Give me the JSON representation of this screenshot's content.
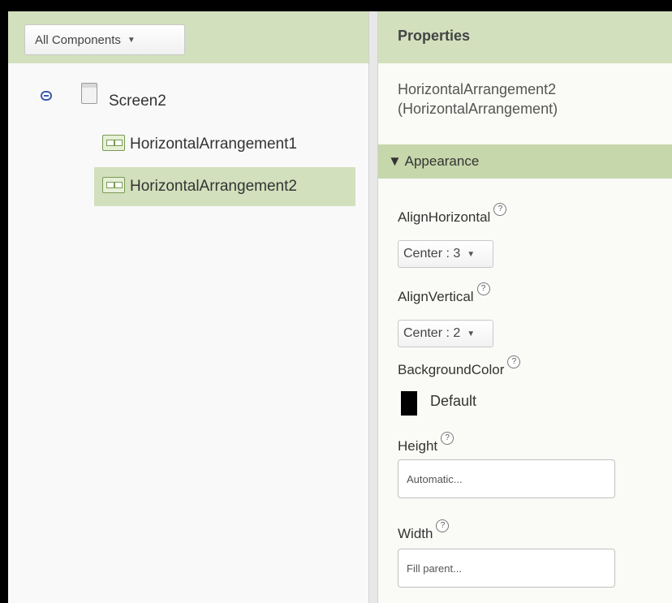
{
  "components": {
    "dropdown_label": "All Components",
    "tree": {
      "root": "Screen2",
      "children": [
        "HorizontalArrangement1",
        "HorizontalArrangement2"
      ],
      "selected": "HorizontalArrangement2"
    }
  },
  "properties": {
    "header": "Properties",
    "component_name_line1": "HorizontalArrangement2",
    "component_name_line2": "(HorizontalArrangement)",
    "section_label": "▼ Appearance",
    "help_glyph": "?",
    "align_horizontal": {
      "label": "AlignHorizontal",
      "value": "Center : 3"
    },
    "align_vertical": {
      "label": "AlignVertical",
      "value": "Center : 2"
    },
    "background_color": {
      "label": "BackgroundColor",
      "value": "Default",
      "swatch_color": "#000000"
    },
    "height": {
      "label": "Height",
      "value": "Automatic..."
    },
    "width": {
      "label": "Width",
      "value": "Fill parent..."
    }
  },
  "colors": {
    "header_green": "#d2e0bd",
    "section_green": "#c6d7ab"
  }
}
